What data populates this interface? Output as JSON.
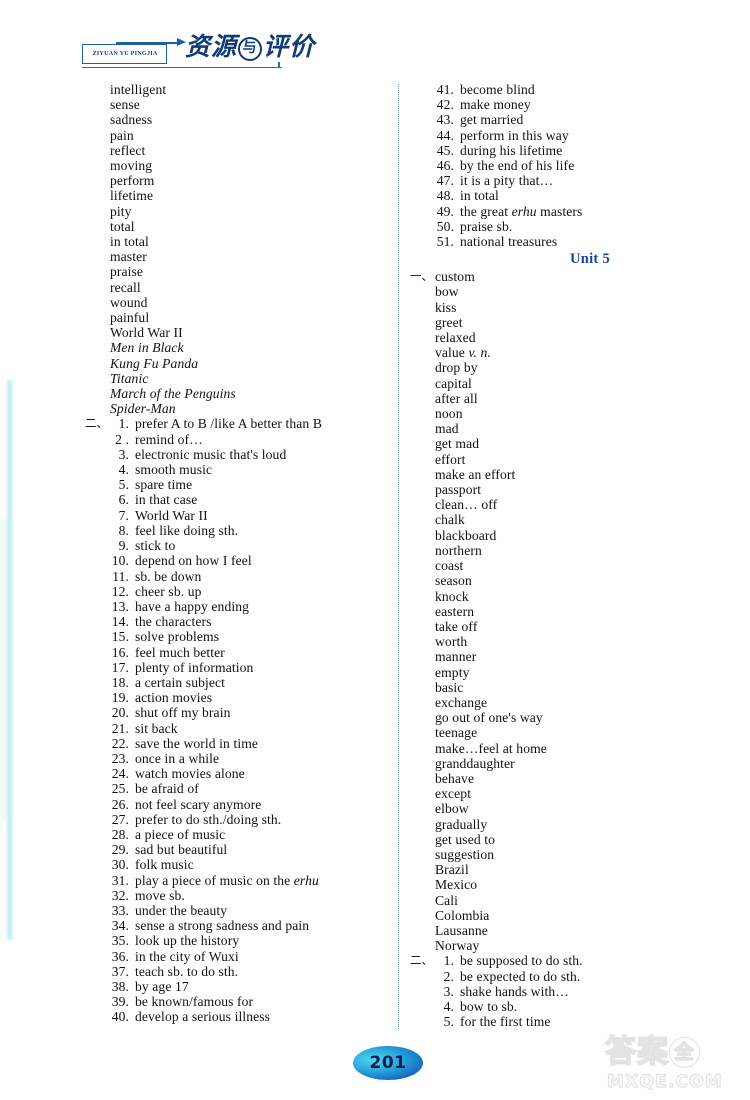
{
  "header": {
    "logo_pinyin": "ZIYUAN YU PINGJIA",
    "logo_cn_part1": "资源",
    "logo_cn_circled": "与",
    "logo_cn_part2": "评价"
  },
  "left_column": {
    "vocab": [
      "intelligent",
      "sense",
      "sadness",
      "pain",
      "reflect",
      "moving",
      "perform",
      "lifetime",
      "pity",
      "total",
      "in total",
      "master",
      "praise",
      "recall",
      "wound",
      "painful",
      "World War II"
    ],
    "titles": [
      "Men in Black",
      "Kung Fu Panda",
      "Titanic",
      "March of the Penguins",
      "Spider-Man"
    ],
    "section_marker": "二、",
    "phrases": [
      {
        "num": "1.",
        "text": "prefer A to B /like A better than B"
      },
      {
        "num": "2 .",
        "text": "remind of…"
      },
      {
        "num": "3.",
        "text": "electronic music that's loud"
      },
      {
        "num": "4.",
        "text": "smooth music"
      },
      {
        "num": "5.",
        "text": "spare time"
      },
      {
        "num": "6.",
        "text": "in that case"
      },
      {
        "num": "7.",
        "text": "World War II"
      },
      {
        "num": "8.",
        "text": "feel like doing sth."
      },
      {
        "num": "9.",
        "text": "stick to"
      },
      {
        "num": "10.",
        "text": "depend on how I feel"
      },
      {
        "num": "11.",
        "text": "sb. be down"
      },
      {
        "num": "12.",
        "text": "cheer sb. up"
      },
      {
        "num": "13.",
        "text": "have a happy ending"
      },
      {
        "num": "14.",
        "text": "the characters"
      },
      {
        "num": "15.",
        "text": "solve problems"
      },
      {
        "num": "16.",
        "text": "feel much better"
      },
      {
        "num": "17.",
        "text": "plenty of information"
      },
      {
        "num": "18.",
        "text": "a certain subject"
      },
      {
        "num": "19.",
        "text": "action movies"
      },
      {
        "num": "20.",
        "text": "shut off my brain"
      },
      {
        "num": "21.",
        "text": "sit back"
      },
      {
        "num": "22.",
        "text": "save the world in time"
      },
      {
        "num": "23.",
        "text": "once in a while"
      },
      {
        "num": "24.",
        "text": "watch movies alone"
      },
      {
        "num": "25.",
        "text": "be afraid of"
      },
      {
        "num": "26.",
        "text": "not feel scary anymore"
      },
      {
        "num": "27.",
        "text": "prefer to do sth./doing sth."
      },
      {
        "num": "28.",
        "text": "a piece of music"
      },
      {
        "num": "29.",
        "text": "sad but beautiful"
      },
      {
        "num": "30.",
        "text": "folk music"
      },
      {
        "num": "31.",
        "text": "play a piece of music on the ",
        "italic_tail": "erhu"
      },
      {
        "num": "32.",
        "text": "move sb."
      },
      {
        "num": "33.",
        "text": "under the beauty"
      },
      {
        "num": "34.",
        "text": "sense a strong sadness and pain"
      },
      {
        "num": "35.",
        "text": "look up the history"
      },
      {
        "num": "36.",
        "text": "in the city of Wuxi"
      },
      {
        "num": "37.",
        "text": "teach sb. to do sth."
      },
      {
        "num": "38.",
        "text": "by age 17"
      },
      {
        "num": "39.",
        "text": "be known/famous for"
      },
      {
        "num": "40.",
        "text": "develop a serious illness"
      }
    ]
  },
  "right_column": {
    "phrases_continued": [
      {
        "num": "41.",
        "text": "become blind"
      },
      {
        "num": "42.",
        "text": "make money"
      },
      {
        "num": "43.",
        "text": "get married"
      },
      {
        "num": "44.",
        "text": "perform in this way"
      },
      {
        "num": "45.",
        "text": "during his lifetime"
      },
      {
        "num": "46.",
        "text": "by the end of his life"
      },
      {
        "num": "47.",
        "text": "it is a pity that…"
      },
      {
        "num": "48.",
        "text": "in total"
      },
      {
        "num": "49.",
        "text": "the great ",
        "italic_mid": "erhu",
        "text_tail": " masters"
      },
      {
        "num": "50.",
        "text": "praise sb."
      },
      {
        "num": "51.",
        "text": "national treasures"
      }
    ],
    "unit_heading": "Unit 5",
    "section_marker_1": "一、",
    "vocab": [
      "custom",
      "bow",
      "kiss",
      "greet",
      "relaxed",
      "value v. n.",
      "drop by",
      "capital",
      "after all",
      "noon",
      "mad",
      "get mad",
      "effort",
      "make an effort",
      "passport",
      "clean… off",
      "chalk",
      "blackboard",
      "northern",
      "coast",
      "season",
      "knock",
      "eastern",
      "take off",
      "worth",
      "manner",
      "empty",
      "basic",
      "exchange",
      "go out of one's way",
      "teenage",
      "make…feel at home",
      "granddaughter",
      "behave",
      "except",
      "elbow",
      "gradually",
      "get used to",
      "suggestion",
      "Brazil",
      "Mexico",
      "Cali",
      "Colombia",
      "Lausanne",
      "Norway"
    ],
    "vocab_value_word": "value",
    "vocab_value_abbr": "v. n.",
    "section_marker_2": "二、",
    "phrases_unit5": [
      {
        "num": "1.",
        "text": "be supposed to do sth."
      },
      {
        "num": "2.",
        "text": "be expected to do sth."
      },
      {
        "num": "3.",
        "text": "shake hands with…"
      },
      {
        "num": "4.",
        "text": "bow to sb."
      },
      {
        "num": "5.",
        "text": "for the first time"
      }
    ]
  },
  "footer": {
    "page_number": "201",
    "watermark_cn_part1": "答案",
    "watermark_cn_circled": "全",
    "watermark_domain": "MXQE.COM"
  },
  "colors": {
    "logo_blue": "#123b76",
    "unit_blue": "#16499a",
    "page_badge_blue": "#1565c0",
    "watermark_gray": "#e3e3e3"
  }
}
